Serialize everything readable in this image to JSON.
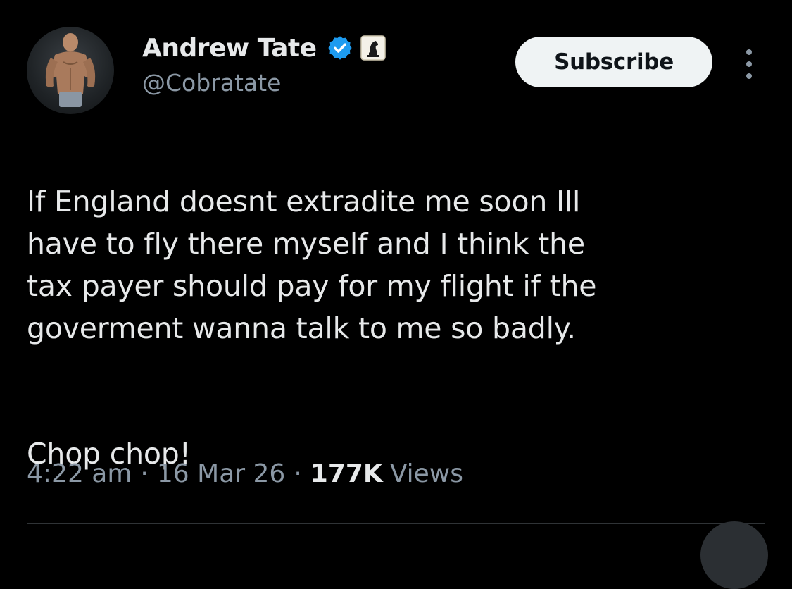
{
  "author": {
    "display_name": "Andrew Tate",
    "handle": "@Cobratate",
    "verified_icon": "verified-badge-icon",
    "affiliate_icon": "chess-knight-affiliate-icon"
  },
  "actions": {
    "subscribe_label": "Subscribe",
    "more_icon": "more-vertical-icon"
  },
  "tweet": {
    "paragraphs": [
      "If England doesnt extradite me soon Ill\nhave to fly there myself and I think the\ntax payer should pay for my flight if the\ngoverment wanna talk to me so badly.",
      "Chop chop!"
    ],
    "time": "4:22 am",
    "separator": "·",
    "date": "16 Mar 26",
    "views_count": "177K",
    "views_label": "Views"
  },
  "colors": {
    "background": "#000000",
    "text_primary": "#e7e9ea",
    "text_secondary": "#8b98a5",
    "verified_blue": "#1d9bf0",
    "button_bg": "#eff3f4"
  }
}
